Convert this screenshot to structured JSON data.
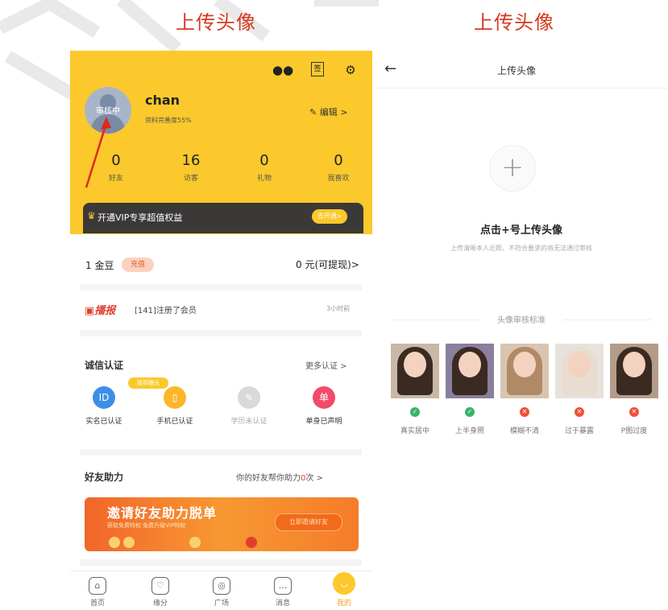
{
  "captions": {
    "left": "上传头像",
    "right": "上传头像"
  },
  "profile": {
    "username": "chan",
    "completion": "资料完善度55%",
    "avatar_status": "审核中",
    "edit_label": "编辑 >",
    "stats": [
      {
        "value": "0",
        "label": "好友"
      },
      {
        "value": "16",
        "label": "访客"
      },
      {
        "value": "0",
        "label": "礼物"
      },
      {
        "value": "0",
        "label": "我喜欢"
      }
    ],
    "vip_text": "开通VIP专享超值权益",
    "vip_button": "去开通>"
  },
  "wallet": {
    "gold": "1 金豆",
    "recharge": "充值",
    "cash": "0 元(可提现)>"
  },
  "news": {
    "logo": "播报",
    "message": "[141]注册了会员",
    "time": "3小时前"
  },
  "certification": {
    "title": "诚信认证",
    "more": "更多认证 >",
    "badge": "提高曝光",
    "items": [
      {
        "label": "实名已认证",
        "icon": "id-card-icon",
        "color": "#3c8fe6",
        "glyph": "ID"
      },
      {
        "label": "手机已认证",
        "icon": "phone-icon",
        "color": "#fbb62a",
        "glyph": "▯"
      },
      {
        "label": "学历未认证",
        "icon": "graduation-icon",
        "color": "#d9d9d9",
        "glyph": "✎"
      },
      {
        "label": "单身已声明",
        "icon": "single-icon",
        "color": "#f24b6a",
        "glyph": "单"
      }
    ]
  },
  "friends": {
    "title": "好友助力",
    "desc_prefix": "你的好友帮你助力",
    "count": "0",
    "desc_suffix": "次 >",
    "banner_title": "邀请好友助力脱单",
    "banner_sub": "获取免费特权 免费升级VIP特权",
    "banner_button": "立即邀请好友"
  },
  "tabs": [
    {
      "label": "首页",
      "glyph": "⌂",
      "name": "tab-home"
    },
    {
      "label": "缘分",
      "glyph": "♡",
      "name": "tab-fate"
    },
    {
      "label": "广场",
      "glyph": "◎",
      "name": "tab-square"
    },
    {
      "label": "消息",
      "glyph": "…",
      "name": "tab-messages"
    },
    {
      "label": "我的",
      "glyph": "◡",
      "name": "tab-mine"
    }
  ],
  "upload": {
    "back": "←",
    "title": "上传头像",
    "plus": "+",
    "main": "点击+号上传头像",
    "sub": "上传清晰本人近照，不符合要求的将无法通过审核",
    "standard_title": "头像审核标准",
    "examples": [
      {
        "label": "真实居中",
        "ok": true,
        "bg": "#c9b8a6"
      },
      {
        "label": "上半身照",
        "ok": true,
        "bg": "#8a7f9c"
      },
      {
        "label": "模糊不清",
        "ok": false,
        "bg": "#d9c4b0"
      },
      {
        "label": "过于暴露",
        "ok": false,
        "bg": "#e8e2dc"
      },
      {
        "label": "P图过度",
        "ok": false,
        "bg": "#b49c8a"
      }
    ],
    "ok_color": "#3bb36a",
    "bad_color": "#f0503a"
  }
}
